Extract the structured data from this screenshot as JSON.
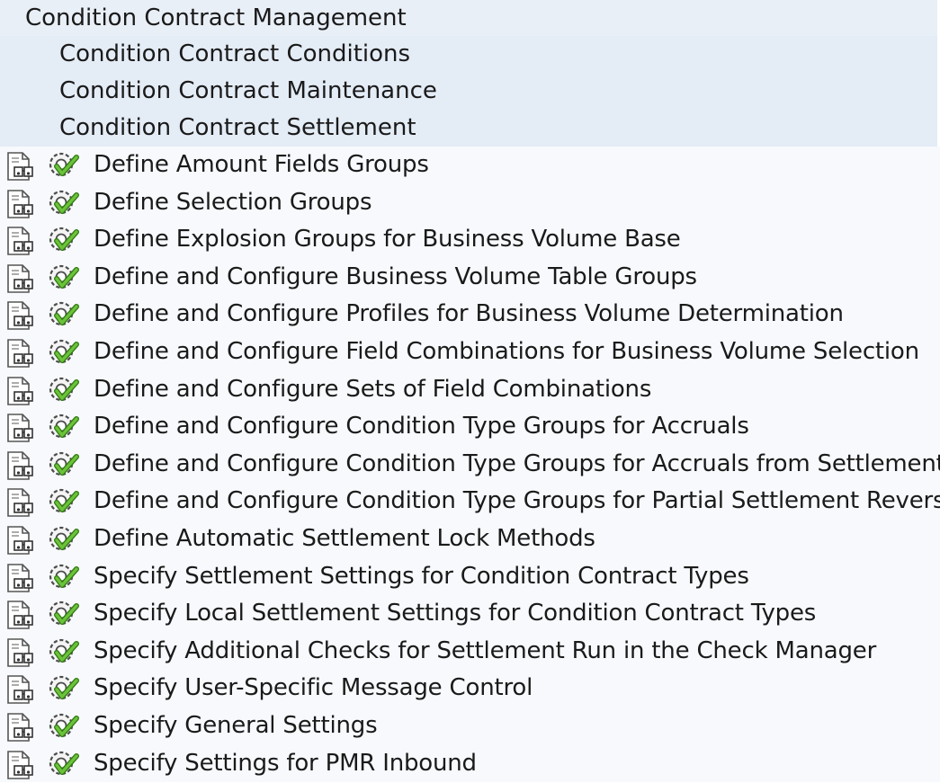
{
  "tree": {
    "node_level1": {
      "label": "Condition Contract Management"
    },
    "nodes_level2": [
      {
        "label": "Condition Contract Conditions"
      },
      {
        "label": "Condition Contract Maintenance"
      },
      {
        "label": "Condition Contract Settlement"
      }
    ],
    "activities": [
      {
        "label": "Define Amount Fields Groups"
      },
      {
        "label": "Define Selection Groups"
      },
      {
        "label": "Define Explosion Groups for Business Volume Base"
      },
      {
        "label": "Define and Configure Business Volume Table Groups"
      },
      {
        "label": "Define and Configure Profiles for Business Volume Determination"
      },
      {
        "label": "Define and Configure Field Combinations for Business Volume Selection"
      },
      {
        "label": "Define and Configure Sets of Field Combinations"
      },
      {
        "label": "Define and Configure Condition Type Groups for Accruals"
      },
      {
        "label": "Define and Configure Condition Type Groups for Accruals from Settlement"
      },
      {
        "label": "Define and Configure Condition Type Groups for Partial Settlement Reversal"
      },
      {
        "label": "Define Automatic Settlement Lock Methods"
      },
      {
        "label": "Specify Settlement Settings for Condition Contract Types"
      },
      {
        "label": "Specify Local Settlement Settings for Condition Contract Types"
      },
      {
        "label": "Specify Additional Checks for Settlement Run in the Check Manager"
      },
      {
        "label": "Specify User-Specific Message Control"
      },
      {
        "label": "Specify General Settings"
      },
      {
        "label": "Specify Settings for PMR Inbound"
      }
    ],
    "icons": {
      "documentation": "documentation-icon",
      "execute": "execute-activity-icon"
    }
  },
  "colors": {
    "node_background": "#e4ecf6",
    "activity_background": "#f7f9fc",
    "execute_icon_green": "#3f9a1e"
  }
}
